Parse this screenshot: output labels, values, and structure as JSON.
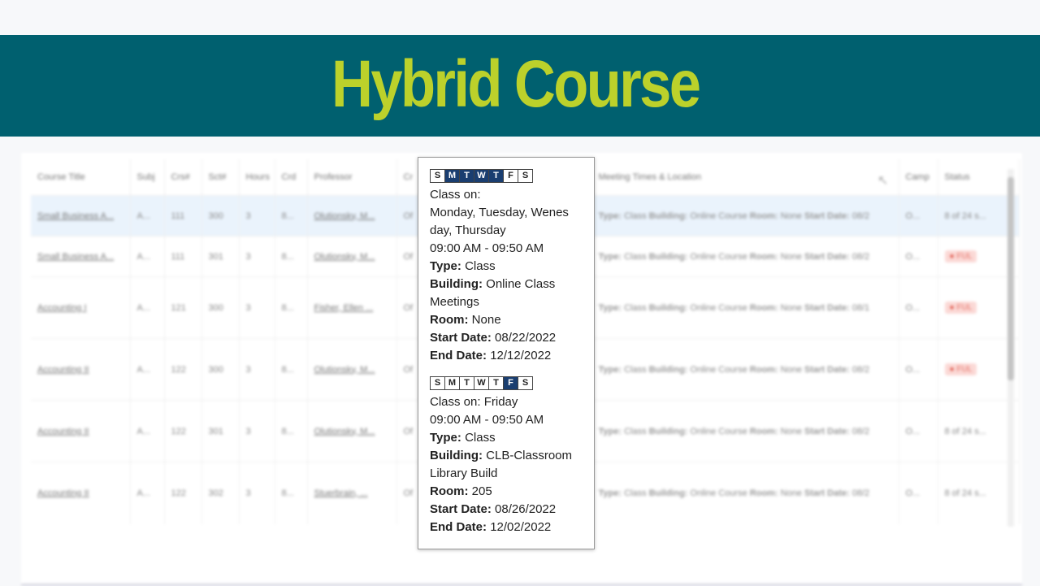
{
  "banner": {
    "title": "Hybrid Course"
  },
  "table": {
    "headers": [
      "Course Title",
      "Subj",
      "Crs#",
      "Sct#",
      "Hours",
      "Crd",
      "Professor",
      "Cr",
      "Meeting Times & Location",
      "Camp",
      "Status"
    ],
    "rows": [
      {
        "title": "Small Business A...",
        "subj": "A...",
        "crs": "111",
        "sct": "300",
        "hours": "3",
        "crd": "8...",
        "prof": "Olutionsky, M...",
        "cr": "Of",
        "meet_prefix": "Type:",
        "meet_type": "Class",
        "meet_b": "Building:",
        "meet_bval": "Online Course",
        "meet_r": "Room:",
        "meet_rval": "None",
        "meet_s": "Start Date:",
        "meet_sval": "08/2",
        "camp": "O...",
        "status": "8 of 24 s...",
        "fail": false
      },
      {
        "title": "Small Business A...",
        "subj": "A...",
        "crs": "111",
        "sct": "301",
        "hours": "3",
        "crd": "8...",
        "prof": "Olutionsky, M...",
        "cr": "Of",
        "meet_prefix": "Type:",
        "meet_type": "Class",
        "meet_b": "Building:",
        "meet_bval": "Online Course",
        "meet_r": "Room:",
        "meet_rval": "None",
        "meet_s": "Start Date:",
        "meet_sval": "08/2",
        "camp": "O...",
        "status": "FUL",
        "fail": true
      },
      {
        "title": "Accounting I",
        "subj": "A...",
        "crs": "121",
        "sct": "300",
        "hours": "3",
        "crd": "8...",
        "prof": "Fisher, Ellen ...",
        "cr": "Of",
        "meet_prefix": "Type:",
        "meet_type": "Class",
        "meet_b": "Building:",
        "meet_bval": "Online Course",
        "meet_r": "Room:",
        "meet_rval": "None",
        "meet_s": "Start Date:",
        "meet_sval": "08/1",
        "camp": "O...",
        "status": "FUL",
        "fail": true
      },
      {
        "title": "Accounting II",
        "subj": "A...",
        "crs": "122",
        "sct": "300",
        "hours": "3",
        "crd": "8...",
        "prof": "Olutionsky, M...",
        "cr": "Of",
        "meet_prefix": "Type:",
        "meet_type": "Class",
        "meet_b": "Building:",
        "meet_bval": "Online Course",
        "meet_r": "Room:",
        "meet_rval": "None",
        "meet_s": "Start Date:",
        "meet_sval": "08/2",
        "camp": "O...",
        "status": "FUL",
        "fail": true
      },
      {
        "title": "Accounting II",
        "subj": "A...",
        "crs": "122",
        "sct": "301",
        "hours": "3",
        "crd": "8...",
        "prof": "Olutionsky, M...",
        "cr": "Of",
        "meet_prefix": "Type:",
        "meet_type": "Class",
        "meet_b": "Building:",
        "meet_bval": "Online Course",
        "meet_r": "Room:",
        "meet_rval": "None",
        "meet_s": "Start Date:",
        "meet_sval": "08/2",
        "camp": "O...",
        "status": "8 of 24 s...",
        "fail": false
      },
      {
        "title": "Accounting II",
        "subj": "A...",
        "crs": "122",
        "sct": "302",
        "hours": "3",
        "crd": "8...",
        "prof": "Stuerbrain, ...",
        "cr": "Of",
        "meet_prefix": "Type:",
        "meet_type": "Class",
        "meet_b": "Building:",
        "meet_bval": "Online Course",
        "meet_r": "Room:",
        "meet_rval": "None",
        "meet_s": "Start Date:",
        "meet_sval": "08/2",
        "camp": "O...",
        "status": "8 of 24 s...",
        "fail": false
      }
    ]
  },
  "popup": {
    "meetings": [
      {
        "days": [
          {
            "letter": "S",
            "on": false
          },
          {
            "letter": "M",
            "on": true
          },
          {
            "letter": "T",
            "on": true
          },
          {
            "letter": "W",
            "on": true
          },
          {
            "letter": "T",
            "on": true
          },
          {
            "letter": "F",
            "on": false
          },
          {
            "letter": "S",
            "on": false
          }
        ],
        "class_on_label": "Class on:",
        "class_on_days": "Monday, Tuesday, Wenes day, Thursday",
        "time": "09:00 AM - 09:50 AM",
        "type_label": "Type:",
        "type": "Class",
        "building_label": "Building:",
        "building": "Online Class Meetings",
        "room_label": "Room:",
        "room": "None",
        "start_label": "Start Date:",
        "start": "08/22/2022",
        "end_label": "End Date:",
        "end": "12/12/2022"
      },
      {
        "days": [
          {
            "letter": "S",
            "on": false
          },
          {
            "letter": "M",
            "on": false
          },
          {
            "letter": "T",
            "on": false
          },
          {
            "letter": "W",
            "on": false
          },
          {
            "letter": "T",
            "on": false
          },
          {
            "letter": "F",
            "on": true
          },
          {
            "letter": "S",
            "on": false
          }
        ],
        "class_on_label": "Class on:",
        "class_on_days": "Friday",
        "time": "09:00 AM - 09:50 AM",
        "type_label": "Type:",
        "type": "Class",
        "building_label": "Building:",
        "building": "CLB-Classroom Library Build",
        "room_label": "Room:",
        "room": "205",
        "start_label": "Start Date:",
        "start": "08/26/2022",
        "end_label": "End Date:",
        "end": "12/02/2022"
      }
    ]
  },
  "colors": {
    "banner_bg": "#00606f",
    "banner_text": "#bcd12b",
    "day_on": "#1a3e70"
  }
}
